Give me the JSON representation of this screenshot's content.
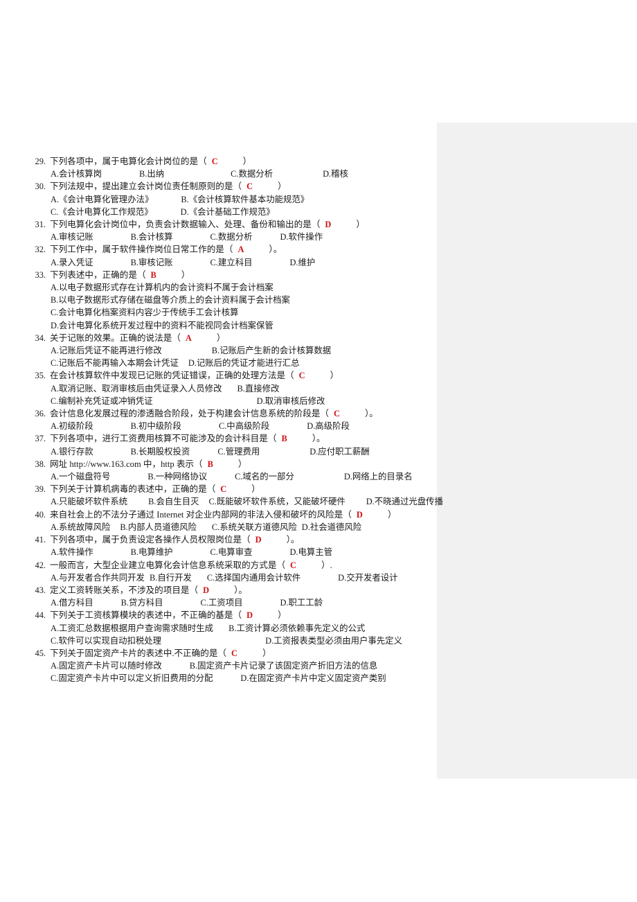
{
  "document": {
    "type": "exam-paper",
    "language": "zh-CN",
    "answer_color": "#d01217",
    "right_panel_color": "#f1f1f1"
  },
  "questions": [
    {
      "number": "29.",
      "stem_before": "下列各项中，属于电算化会计岗位的是（",
      "answer": "C",
      "stem_after": "）",
      "option_lines": [
        [
          {
            "text": "A.会计核算岗",
            "gap": "sp6"
          },
          {
            "text": "B.出纳",
            "gap": "sp8"
          },
          {
            "text": "C.数据分析",
            "gap": "sp7"
          },
          {
            "text": "D.稽核",
            "gap": ""
          }
        ]
      ]
    },
    {
      "number": "30.",
      "stem_before": "下列法规中，提出建立会计岗位责任制原则的是（",
      "answer": "C",
      "stem_after": "）",
      "option_lines": [
        [
          {
            "text": "A.《会计电算化管理办法》",
            "gap": "sp5"
          },
          {
            "text": "B.《会计核算软件基本功能规范》",
            "gap": ""
          }
        ],
        [
          {
            "text": "C.《会计电算化工作规范》",
            "gap": "sp5"
          },
          {
            "text": "D.《会计基础工作规范》",
            "gap": ""
          }
        ]
      ]
    },
    {
      "number": "31.",
      "stem_before": "下列电算化会计岗位中，负责会计数据输入、处理、备份和输出的是（",
      "answer": "D",
      "stem_after": "）",
      "option_lines": [
        [
          {
            "text": "A.审核记账",
            "gap": "sp6"
          },
          {
            "text": "B.会计核算",
            "gap": "sp6"
          },
          {
            "text": "C.数据分析",
            "gap": "sp5"
          },
          {
            "text": "D.软件操作",
            "gap": ""
          }
        ]
      ]
    },
    {
      "number": "32.",
      "stem_before": "下列工作中，属于软件操作岗位日常工作的是（",
      "answer": "A",
      "stem_after": "）。",
      "option_lines": [
        [
          {
            "text": "A.录入凭证",
            "gap": "sp6"
          },
          {
            "text": "B.审核记账",
            "gap": "sp6"
          },
          {
            "text": "C.建立科目",
            "gap": "sp6"
          },
          {
            "text": "D.维护",
            "gap": ""
          }
        ]
      ]
    },
    {
      "number": "33.",
      "stem_before": "下列表述中，正确的是（",
      "answer": "B",
      "stem_after": "）",
      "option_lines": [
        [
          {
            "text": "A.以电子数据形式存在计算机内的会计资料不属于会计档案",
            "gap": ""
          }
        ],
        [
          {
            "text": "B.以电子数据形式存储在磁盘等介质上的会计资料属于会计档案",
            "gap": ""
          }
        ],
        [
          {
            "text": "C.会计电算化档案资料内容少于传统手工会计核算",
            "gap": ""
          }
        ],
        [
          {
            "text": "D.会计电算化系统开发过程中的资料不能视同会计档案保管",
            "gap": ""
          }
        ]
      ]
    },
    {
      "number": "34.",
      "stem_before": "关于记账的效果。正确的说法是（",
      "answer": "A",
      "stem_after": "）",
      "option_lines": [
        [
          {
            "text": "A.记账后凭证不能再进行修改",
            "gap": "sp7"
          },
          {
            "text": "B.记账后产生新的会计核算数据",
            "gap": ""
          }
        ],
        [
          {
            "text": "C.记账后不能再输入本期会计凭证",
            "gap": "sp2"
          },
          {
            "text": "D.记账后的凭证才能进行汇总",
            "gap": ""
          }
        ]
      ]
    },
    {
      "number": "35.",
      "stem_before": "在会计核算软件中发现已记账的凭证错误，正确的处理方法是（",
      "answer": "C",
      "stem_after": "）",
      "option_lines": [
        [
          {
            "text": "A.取消记账、取消审核后由凭证录入人员修改",
            "gap": "sp3"
          },
          {
            "text": "B.直接修改",
            "gap": ""
          }
        ],
        [
          {
            "text": "C.编制补充凭证或冲销凭证",
            "gap": "sp10"
          },
          {
            "text": "D.取消审核后修改",
            "gap": ""
          }
        ]
      ]
    },
    {
      "number": "36.",
      "stem_before": "会计信息化发展过程的渗透融合阶段，处于构建会计信息系统的阶段是（",
      "answer": "C",
      "stem_after": "）。",
      "option_lines": [
        [
          {
            "text": "A.初级阶段",
            "gap": "sp6"
          },
          {
            "text": "B.初中级阶段",
            "gap": "sp6"
          },
          {
            "text": "C.中高级阶段",
            "gap": "sp6"
          },
          {
            "text": "D.高级阶段",
            "gap": ""
          }
        ]
      ]
    },
    {
      "number": "37.",
      "stem_before": "下列各项中，进行工资费用核算不可能涉及的会计科目是（",
      "answer": "B",
      "stem_after": "）。",
      "option_lines": [
        [
          {
            "text": "A.银行存款",
            "gap": "sp6"
          },
          {
            "text": "B.长期股权投资",
            "gap": "sp5"
          },
          {
            "text": "C.管理费用",
            "gap": "sp7"
          },
          {
            "text": "D.应付职工薪酬",
            "gap": ""
          }
        ]
      ]
    },
    {
      "number": "38.",
      "stem_before": "网址 http://www.163.com 中，http 表示（",
      "answer": "B",
      "stem_after": "）",
      "option_lines": [
        [
          {
            "text": "A.一个磁盘符号",
            "gap": "sp6"
          },
          {
            "text": "B.一种网络协议",
            "gap": "sp5"
          },
          {
            "text": "C.域名的一部分",
            "gap": "sp7"
          },
          {
            "text": "D.网络上的目录名",
            "gap": ""
          }
        ]
      ]
    },
    {
      "number": "39.",
      "stem_before": "下列关于计算机病毒的表述中，正确的是（",
      "answer": "C",
      "stem_after": "）",
      "option_lines": [
        [
          {
            "text": "A.只能破坏软件系统",
            "gap": "sp4"
          },
          {
            "text": "B.会自生目灭",
            "gap": "sp2"
          },
          {
            "text": "C.既能破坏软件系统，又能破坏硬件",
            "gap": "sp4"
          },
          {
            "text": "D.不晓通过光盘传播",
            "gap": ""
          }
        ]
      ]
    },
    {
      "number": "40.",
      "stem_before": "来自社会上的不法分子通过 Internet 对企业内部网的非法入侵和破坏的风险是（",
      "answer": "D",
      "stem_after": "）",
      "option_lines": [
        [
          {
            "text": "A.系统故障风险",
            "gap": "sp2"
          },
          {
            "text": "B.内部人员道德风险",
            "gap": "sp3"
          },
          {
            "text": "C.系统关联方道德风险",
            "gap": "sp1"
          },
          {
            "text": "D.社会道德风险",
            "gap": ""
          }
        ]
      ]
    },
    {
      "number": "41.",
      "stem_before": "下列各项中，属于负责设定各操作人员权限岗位是（",
      "answer": "D",
      "stem_after": "）。",
      "option_lines": [
        [
          {
            "text": "A.软件操作",
            "gap": "sp6"
          },
          {
            "text": "B.电算维护",
            "gap": "sp6"
          },
          {
            "text": "C.电算审查",
            "gap": "sp6"
          },
          {
            "text": "D.电算主管",
            "gap": ""
          }
        ]
      ]
    },
    {
      "number": "42.",
      "stem_before": "一般而言，大型企业建立电算化会计信息系统采取的方式是（",
      "answer": "C",
      "stem_after": "）.",
      "option_lines": [
        [
          {
            "text": "A.与开发者合作共同开发",
            "gap": "sp1"
          },
          {
            "text": "B.自行开发",
            "gap": "sp3"
          },
          {
            "text": "C.选择国内通用会计软件",
            "gap": "sp6"
          },
          {
            "text": "D.交开发者设计",
            "gap": ""
          }
        ]
      ]
    },
    {
      "number": "43.",
      "stem_before": "定义工资转账关系，不涉及的项目是（",
      "answer": "D",
      "stem_after": "）。",
      "option_lines": [
        [
          {
            "text": "A.借方科目",
            "gap": "sp5"
          },
          {
            "text": "B.贷方科目",
            "gap": "sp6"
          },
          {
            "text": "C.工资项目",
            "gap": "sp6"
          },
          {
            "text": "D.职工工龄",
            "gap": ""
          }
        ]
      ]
    },
    {
      "number": "44.",
      "stem_before": "下列关于工资核算模块的表述中，不正确的基是（",
      "answer": "D",
      "stem_after": "）",
      "option_lines": [
        [
          {
            "text": "A.工资汇总数据根据用户查询需求随时生成",
            "gap": "sp3"
          },
          {
            "text": "B.工资计算必须依赖事先定义的公式",
            "gap": ""
          }
        ],
        [
          {
            "text": "C.软件可以实现自动扣税处理",
            "gap": "sp10"
          },
          {
            "text": "D.工资报表类型必须由用户事先定义",
            "gap": ""
          }
        ]
      ]
    },
    {
      "number": "45.",
      "stem_before": "下列关于固定资产卡片的表述中.不正确的是（",
      "answer": "C",
      "stem_after": "）",
      "option_lines": [
        [
          {
            "text": "A.固定资产卡片可以随时修改",
            "gap": "sp5"
          },
          {
            "text": "B.固定资产卡片记录了该固定资产折旧方法的信息",
            "gap": ""
          }
        ],
        [
          {
            "text": "C.固定资产卡片中可以定义折旧费用的分配",
            "gap": "sp5"
          },
          {
            "text": "D.在固定资产卡片中定义固定资产类别",
            "gap": ""
          }
        ]
      ]
    }
  ]
}
